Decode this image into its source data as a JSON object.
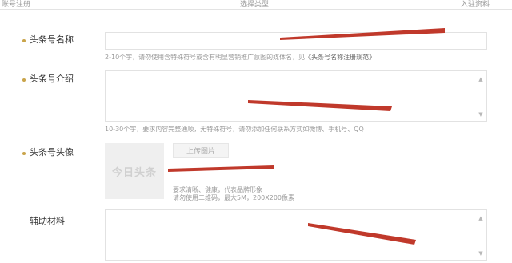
{
  "steps": {
    "step1": "账号注册",
    "step2": "选择类型",
    "step3": "入驻资料"
  },
  "name_field": {
    "label": "头条号名称",
    "hint_prefix": "2-10个字，请勿使用含特殊符号或含有明显营销推广意图的媒体名，见",
    "hint_link": "《头条号名称注册规范》"
  },
  "intro_field": {
    "label": "头条号介绍",
    "hint": "10-30个字，要求内容完整通顺，无特殊符号，请勿添加任何联系方式如微博、手机号、QQ"
  },
  "avatar_field": {
    "label": "头条号头像",
    "placeholder_text": "今日头条",
    "upload_label": "上传图片",
    "hint_line1": "要求清晰、健康，代表品牌形象",
    "hint_line2": "请勿使用二维码，最大5M，200X200像素"
  },
  "support_field": {
    "label": "辅助材料"
  },
  "annotation_colors": {
    "arrow": "#c0392b",
    "required_dot": "#c9a44a"
  }
}
